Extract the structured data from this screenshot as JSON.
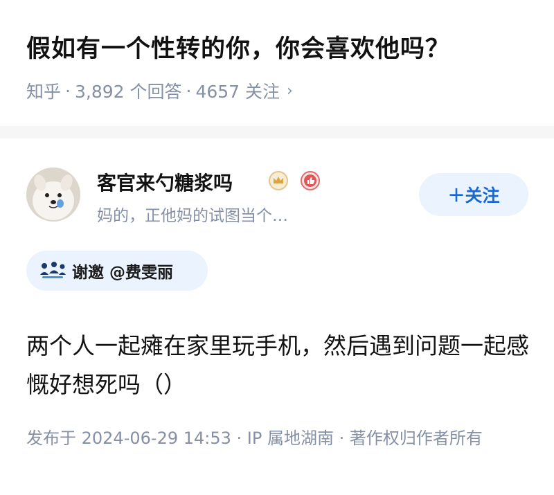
{
  "question": {
    "title": "假如有一个性转的你，你会喜欢他吗？",
    "source": "知乎",
    "answers": "3,892 个回答",
    "followers": "4657 关注",
    "chevron": "›"
  },
  "answer": {
    "author": {
      "name": "客官来勺糖浆吗",
      "headline": "妈的，正他妈的试图当个…",
      "avatar_icon": "samoyed-dog-avatar",
      "badges": [
        "crown-badge-icon",
        "thumbs-up-badge-icon"
      ]
    },
    "follow_button": {
      "label": "＋关注",
      "color": "#1769d6",
      "bg": "#ebf3fe"
    },
    "invite": {
      "icon": "invite-people-icon",
      "label": "谢邀 @费雯丽"
    },
    "content": "两个人一起瘫在家里玩手机，然后遇到问题一起感慨好想死吗（）",
    "footer": "发布于 2024-06-29 14:53 · IP 属地湖南 · 著作权归作者所有"
  },
  "colors": {
    "meta_gray": "#8590a6",
    "title_black": "#121212",
    "divider": "#f6f6f6",
    "accent_blue": "#1769d6"
  }
}
